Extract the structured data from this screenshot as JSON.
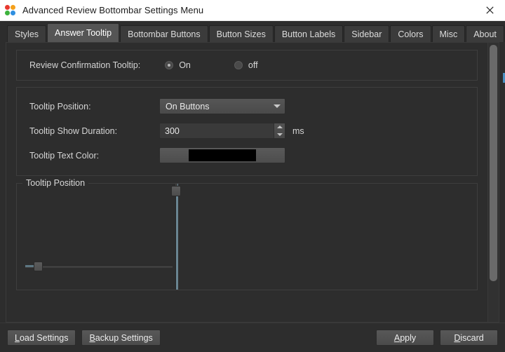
{
  "window": {
    "title": "Advanced Review Bottombar Settings Menu",
    "app_icon": "four-color-dots-icon",
    "close_icon": "close-icon"
  },
  "tabs": [
    {
      "label": "Styles",
      "selected": false
    },
    {
      "label": "Answer Tooltip",
      "selected": true
    },
    {
      "label": "Bottombar Buttons",
      "selected": false
    },
    {
      "label": "Button Sizes",
      "selected": false
    },
    {
      "label": "Button Labels",
      "selected": false
    },
    {
      "label": "Sidebar",
      "selected": false
    },
    {
      "label": "Colors",
      "selected": false
    },
    {
      "label": "Misc",
      "selected": false
    },
    {
      "label": "About",
      "selected": false
    }
  ],
  "settings": {
    "review_confirmation": {
      "label": "Review Confirmation Tooltip:",
      "options": [
        {
          "label": "On",
          "checked": true
        },
        {
          "label": "off",
          "checked": false
        }
      ]
    },
    "tooltip_position": {
      "label": "Tooltip Position:",
      "value": "On Buttons",
      "caret_icon": "chevron-down-icon"
    },
    "tooltip_show_duration": {
      "label": "Tooltip Show Duration:",
      "value": "300",
      "unit": "ms",
      "up_icon": "spin-up-icon",
      "down_icon": "spin-down-icon"
    },
    "tooltip_text_color": {
      "label": "Tooltip Text Color:",
      "color": "#000000"
    }
  },
  "position_group": {
    "title": "Tooltip Position",
    "horizontal_slider": {
      "name": "horizontal-position-slider"
    },
    "vertical_slider": {
      "name": "vertical-position-slider"
    }
  },
  "footer": {
    "load_settings": "Load Settings",
    "backup_settings": "Backup Settings",
    "apply": "Apply",
    "discard": "Discard"
  },
  "colors": {
    "window_bg": "#2d2d2d",
    "titlebar_bg": "#ffffff",
    "tab_selected_bg": "#555555",
    "text": "#d8d8d8",
    "accent_sliver": "#4a90c2"
  }
}
